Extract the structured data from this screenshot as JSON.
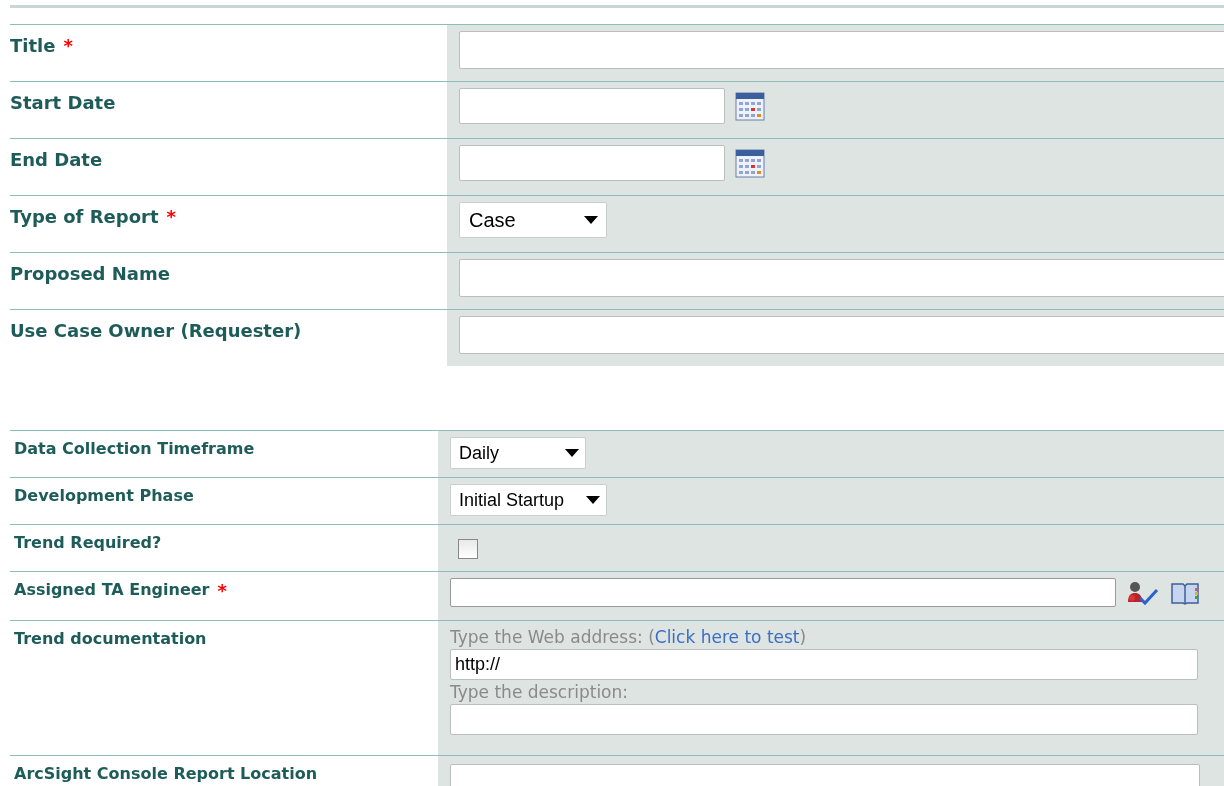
{
  "sections": [
    {
      "rows": [
        {
          "label": "Title",
          "required_mark": "*",
          "kind": "text"
        },
        {
          "label": "Start Date",
          "kind": "date"
        },
        {
          "label": "End Date",
          "kind": "date"
        },
        {
          "label": "Type of Report",
          "required_mark": "*",
          "kind": "select",
          "value": "Case"
        },
        {
          "label": "Proposed Name",
          "kind": "text"
        },
        {
          "label": "Use Case Owner (Requester)",
          "kind": "text"
        }
      ]
    },
    {
      "rows": [
        {
          "label": "Data Collection Timeframe",
          "kind": "select",
          "value": "Daily"
        },
        {
          "label": "Development Phase",
          "kind": "select",
          "value": "Initial Startup"
        },
        {
          "label": "Trend Required?",
          "kind": "checkbox",
          "checked": false
        },
        {
          "label": "Assigned TA Engineer",
          "required_mark": "*",
          "kind": "people"
        },
        {
          "label": "Trend documentation",
          "kind": "url",
          "hint_prefix": "Type the Web address: (",
          "link": "Click here to test",
          "hint_suffix": ")",
          "value": "http://",
          "description_hint": "Type the description:"
        },
        {
          "label": "ArcSight Console Report Location",
          "kind": "text"
        }
      ]
    }
  ]
}
